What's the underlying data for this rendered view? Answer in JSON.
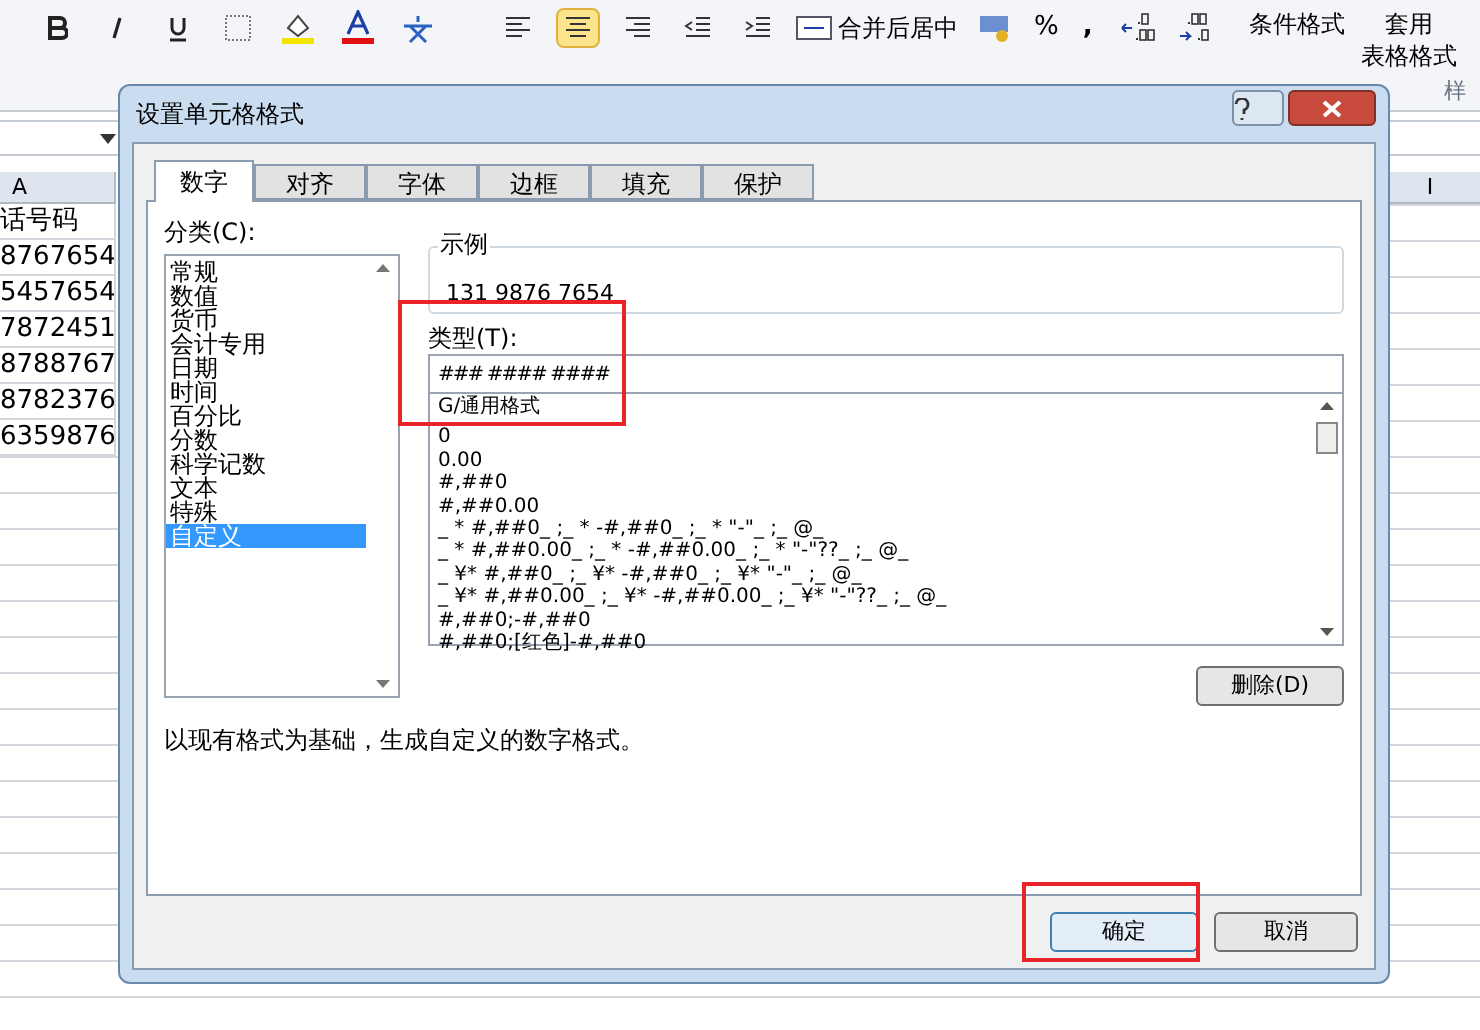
{
  "ribbon": {
    "merge_button": "合并后居中",
    "percent_button": "%",
    "comma_button": ",",
    "conditional_format": "条件格式",
    "table_format_top": "套用",
    "table_format": "表格格式",
    "styles_group": "样"
  },
  "sheet": {
    "column_headers": [
      "A",
      "I"
    ],
    "column_a": [
      "话号码",
      "8767654",
      "5457654",
      "7872451",
      "8788767",
      "8782376",
      "6359876"
    ]
  },
  "dialog": {
    "title": "设置单元格格式",
    "tabs": [
      {
        "label": "数字",
        "selected": true
      },
      {
        "label": "对齐",
        "selected": false
      },
      {
        "label": "字体",
        "selected": false
      },
      {
        "label": "边框",
        "selected": false
      },
      {
        "label": "填充",
        "selected": false
      },
      {
        "label": "保护",
        "selected": false
      }
    ],
    "category_label": "分类(C):",
    "categories": [
      {
        "label": "常规",
        "selected": false
      },
      {
        "label": "数值",
        "selected": false
      },
      {
        "label": "货币",
        "selected": false
      },
      {
        "label": "会计专用",
        "selected": false
      },
      {
        "label": "日期",
        "selected": false
      },
      {
        "label": "时间",
        "selected": false
      },
      {
        "label": "百分比",
        "selected": false
      },
      {
        "label": "分数",
        "selected": false
      },
      {
        "label": "科学记数",
        "selected": false
      },
      {
        "label": "文本",
        "selected": false
      },
      {
        "label": "特殊",
        "selected": false
      },
      {
        "label": "自定义",
        "selected": true
      }
    ],
    "sample_label": "示例",
    "sample_value": "131 9876 7654",
    "type_label": "类型(T):",
    "type_value": "### #### ####",
    "formats": [
      "G/通用格式",
      "0",
      "0.00",
      "#,##0",
      "#,##0.00",
      "_ * #,##0_ ;_ * -#,##0_ ;_ * \"-\"_ ;_ @_",
      "_ * #,##0.00_ ;_ * -#,##0.00_ ;_ * \"-\"??_ ;_ @_",
      "_ ¥* #,##0_ ;_ ¥* -#,##0_ ;_ ¥* \"-\"_ ;_ @_",
      "_ ¥* #,##0.00_ ;_ ¥* -#,##0.00_ ;_ ¥* \"-\"??_ ;_ @_",
      "#,##0;-#,##0",
      "#,##0;[红色]-#,##0"
    ],
    "delete_button": "删除(D)",
    "description": "以现有格式为基础，生成自定义的数字格式。",
    "ok_button": "确定",
    "cancel_button": "取消"
  }
}
